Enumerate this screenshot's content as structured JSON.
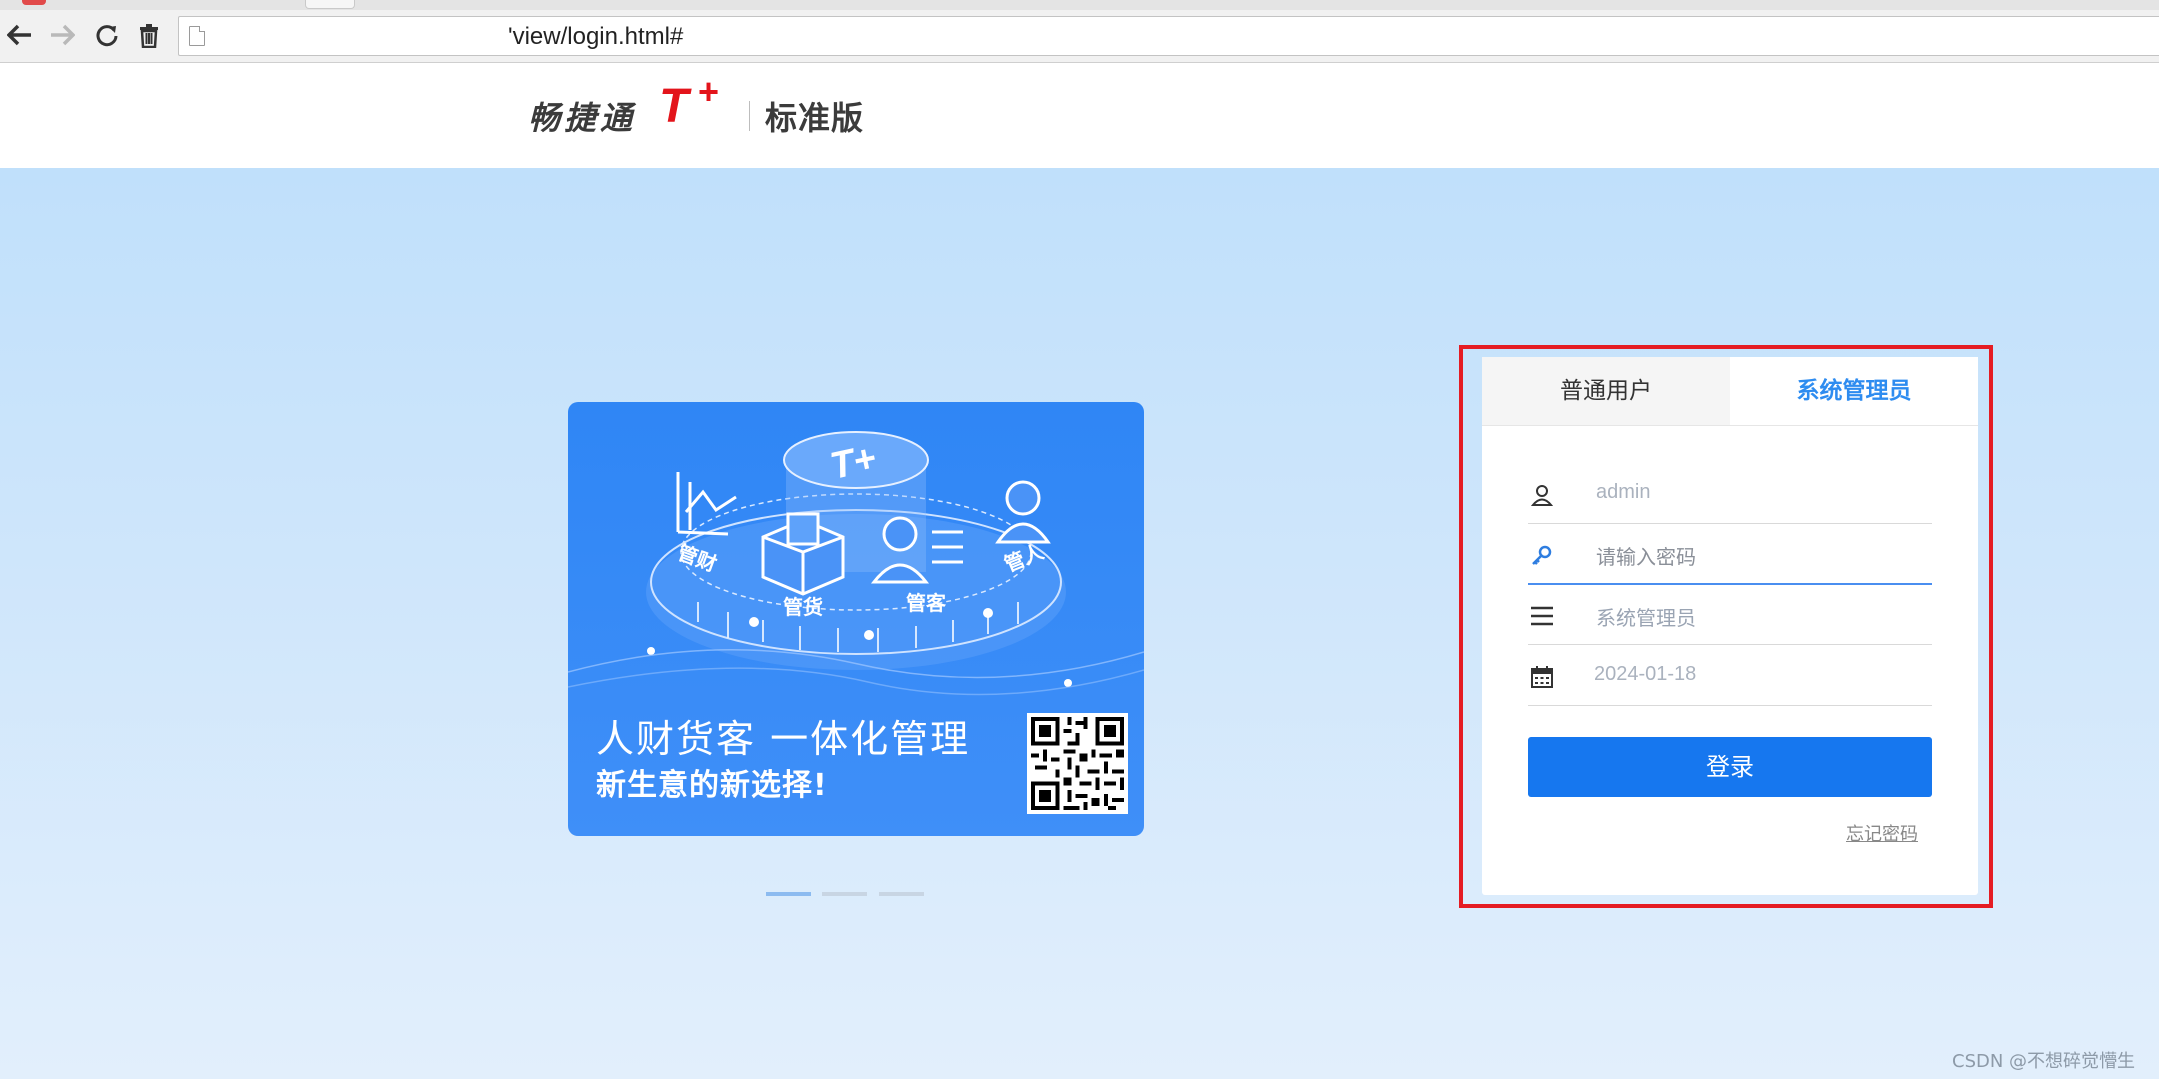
{
  "browser": {
    "url": "'view/login.html#",
    "icons": [
      "back-icon",
      "forward-icon",
      "reload-icon",
      "trash-icon",
      "page-icon"
    ]
  },
  "header": {
    "brand_name": "畅捷通",
    "brand_t": "T",
    "brand_plus": "+",
    "edition": "标准版"
  },
  "promo": {
    "title": "人财货客 一体化管理",
    "subtitle": "新生意的新选择!",
    "labels": [
      "管财",
      "管货",
      "管客",
      "管人"
    ],
    "logo_text": "T+",
    "slides_total": 3,
    "active_slide": 1
  },
  "login": {
    "tabs": [
      "普通用户",
      "系统管理员"
    ],
    "active_tab": "系统管理员",
    "username_value": "admin",
    "password_placeholder": "请输入密码",
    "role_value": "系统管理员",
    "date_value": "2024-01-18",
    "submit_label": "登录",
    "forgot_label": "忘记密码"
  },
  "watermark": "CSDN @不想碎觉懵生",
  "colors": {
    "brand_red": "#e3141b",
    "primary_blue": "#1677ef",
    "active_tab": "#2e8cf0",
    "highlight": "#e51c23"
  }
}
